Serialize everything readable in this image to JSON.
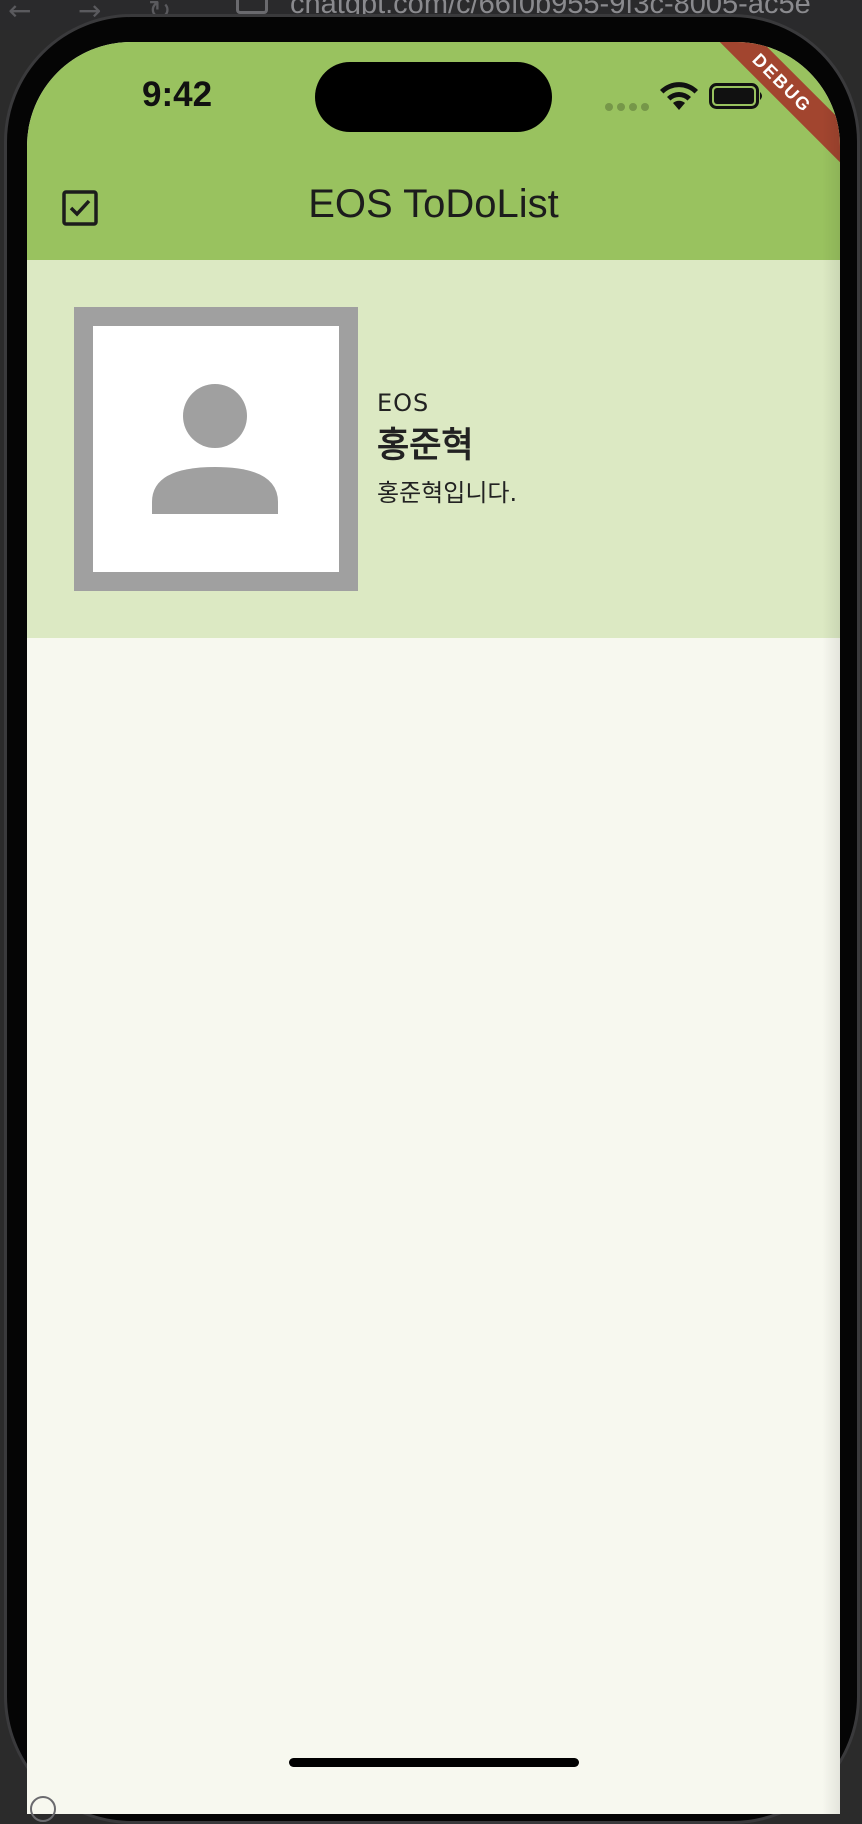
{
  "browser": {
    "url": "chatgpt.com/c/66f0b955-9f3c-8005-ac5e"
  },
  "status_bar": {
    "time": "9:42"
  },
  "debug_banner": {
    "label": "DEBUG",
    "color": "#a2452f"
  },
  "app_bar": {
    "title": "EOS ToDoList",
    "leading_icon": "check-box-icon",
    "color": "#99c25f"
  },
  "profile": {
    "organization": "EOS",
    "name": "홍준혁",
    "description": "홍준혁입니다.",
    "avatar_icon": "person-icon",
    "background_color": "#dce9c3"
  },
  "colors": {
    "body_background": "#f7f8ef",
    "avatar_frame": "#a0a0a0"
  }
}
